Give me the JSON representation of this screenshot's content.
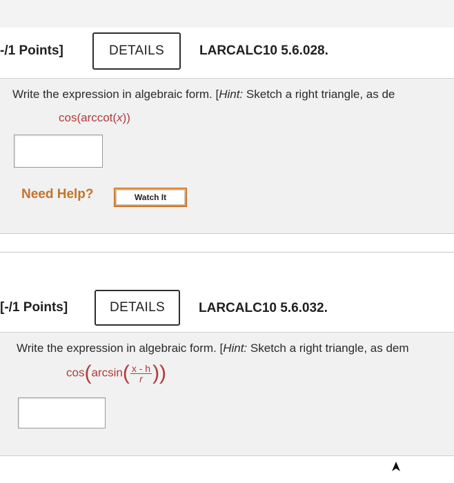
{
  "problem1": {
    "points": "-/1 Points]",
    "details_label": "DETAILS",
    "problem_id": "LARCALC10 5.6.028.",
    "question_prefix": "Write the expression in algebraic form. [",
    "hint_label": "Hint:",
    "question_suffix": " Sketch a right triangle, as de",
    "expression": {
      "func": "cos(arccot(",
      "var": "x",
      "close": "))"
    },
    "answer_value": "",
    "need_help_label": "Need Help?",
    "watch_label": "Watch It"
  },
  "problem2": {
    "points": "[-/1 Points]",
    "details_label": "DETAILS",
    "problem_id": "LARCALC10 5.6.032.",
    "question_prefix": "Write the expression in algebraic form. [",
    "hint_label": "Hint:",
    "question_suffix": " Sketch a right triangle, as dem",
    "expression": {
      "outer": "cos",
      "inner": "arcsin",
      "numerator": "x - h",
      "denominator": "r"
    },
    "answer_value": ""
  },
  "colors": {
    "expression": "#b23a3a",
    "need_help": "#c2742a",
    "watch_button": "#ec8a2a",
    "panel_background": "#f1f1f1"
  }
}
